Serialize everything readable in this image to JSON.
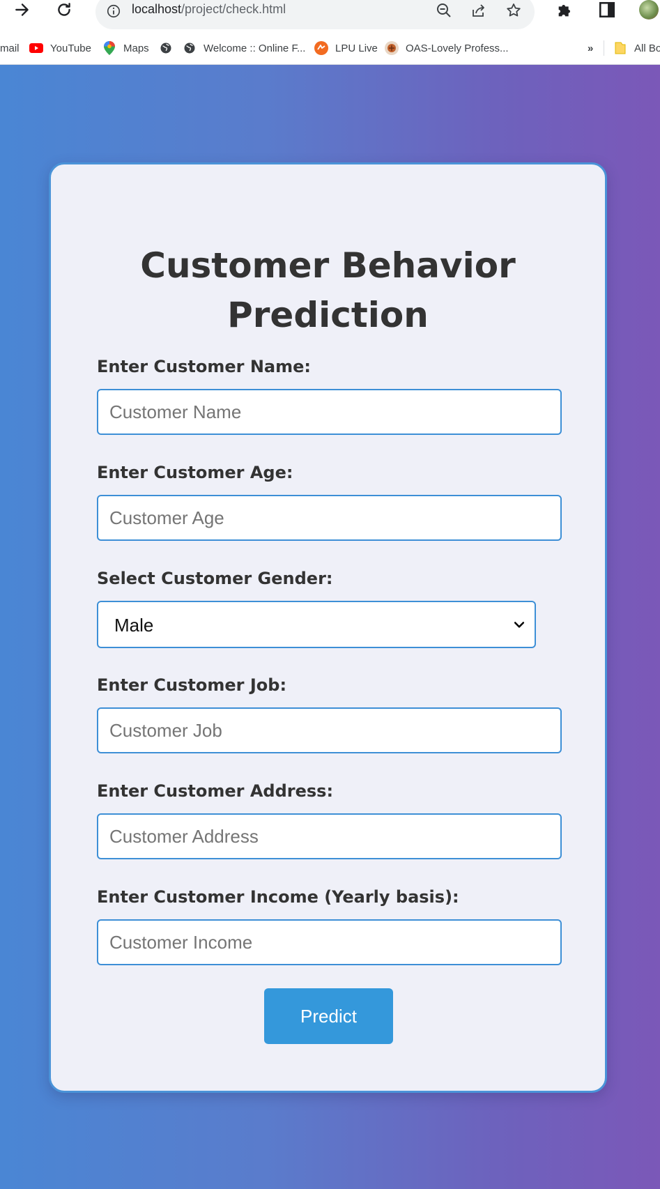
{
  "browser": {
    "url_host": "localhost",
    "url_path": "/project/check.html",
    "bookmarks": [
      {
        "label": "mail",
        "icon": "gmail-icon"
      },
      {
        "label": "YouTube",
        "icon": "youtube-icon"
      },
      {
        "label": "Maps",
        "icon": "maps-icon"
      },
      {
        "label": "",
        "icon": "globe-icon"
      },
      {
        "label": "Welcome :: Online F...",
        "icon": "globe-icon"
      },
      {
        "label": "LPU Live",
        "icon": "lpu-live-icon"
      },
      {
        "label": "OAS-Lovely Profess...",
        "icon": "oas-icon"
      }
    ],
    "more_bookmarks": "»",
    "all_bookmarks": "All Bo",
    "colors": {
      "youtube": "#ff0000",
      "lpu": "#f26b21",
      "folder": "#fdd663"
    }
  },
  "form": {
    "title": "Customer Behavior Prediction",
    "fields": {
      "name": {
        "label": "Enter Customer Name:",
        "placeholder": "Customer Name"
      },
      "age": {
        "label": "Enter Customer Age:",
        "placeholder": "Customer Age"
      },
      "gender": {
        "label": "Select Customer Gender:",
        "value": "Male"
      },
      "job": {
        "label": "Enter Customer Job:",
        "placeholder": "Customer Job"
      },
      "address": {
        "label": "Enter Customer Address:",
        "placeholder": "Customer Address"
      },
      "income": {
        "label": "Enter Customer Income (Yearly basis):",
        "placeholder": "Customer Income"
      }
    },
    "submit_label": "Predict",
    "colors": {
      "accent": "#3498db",
      "input_border": "#3d8fd6",
      "card_background": "#eff0f8",
      "gradient_start": "#4a86d4",
      "gradient_end": "#7b58b8"
    }
  }
}
